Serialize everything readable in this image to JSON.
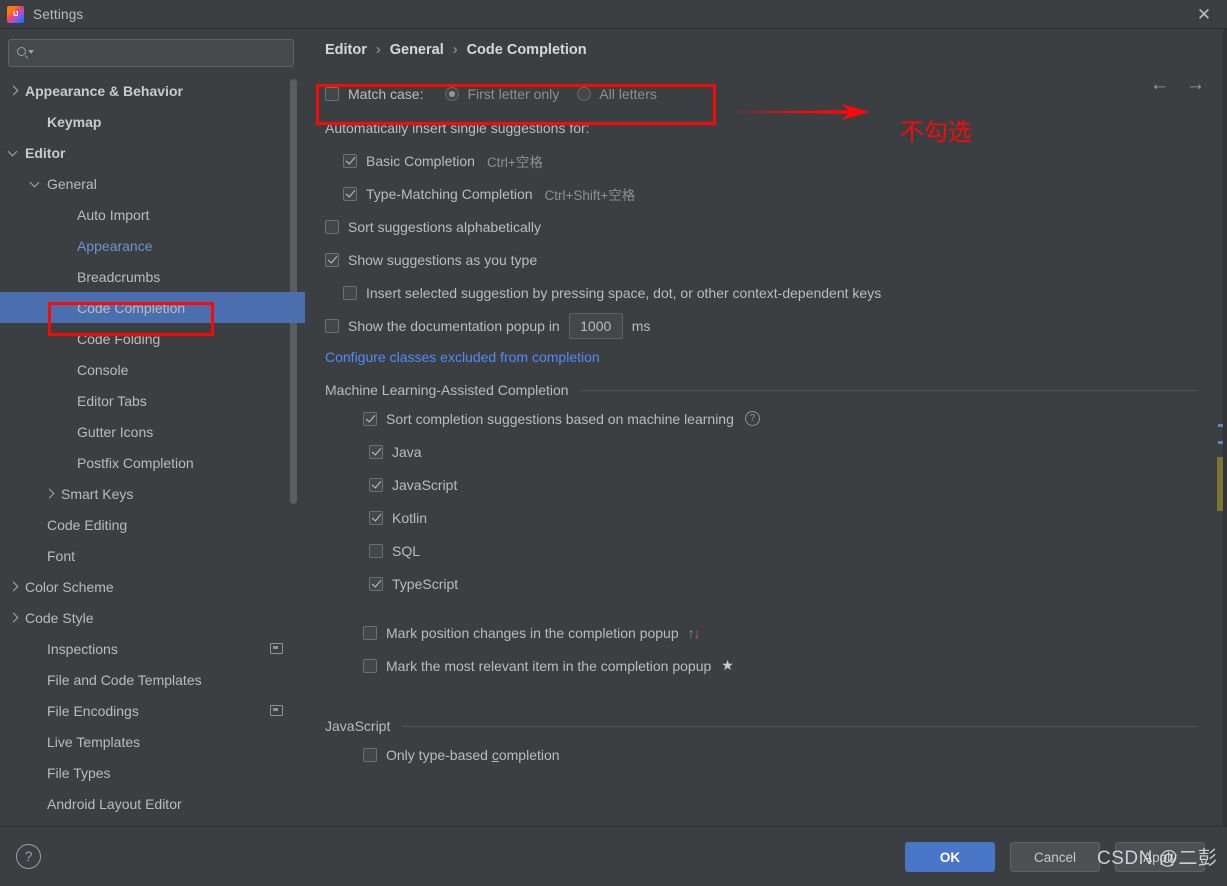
{
  "window": {
    "title": "Settings",
    "logo_icon": "intellij-idea-logo",
    "close_icon": "close-icon"
  },
  "sidebar": {
    "search": {
      "value": "",
      "placeholder": "",
      "icon": "search-icon"
    },
    "items": [
      {
        "label": "Appearance & Behavior",
        "indent": 0,
        "arrow": "right",
        "bold": true,
        "selected": false,
        "accent": false,
        "scope_icon": false
      },
      {
        "label": "Keymap",
        "indent": 1,
        "arrow": "none",
        "bold": true,
        "selected": false,
        "accent": false,
        "scope_icon": false
      },
      {
        "label": "Editor",
        "indent": 0,
        "arrow": "down",
        "bold": true,
        "selected": false,
        "accent": false,
        "scope_icon": false
      },
      {
        "label": "General",
        "indent": 1,
        "arrow": "down",
        "bold": false,
        "selected": false,
        "accent": false,
        "scope_icon": false
      },
      {
        "label": "Auto Import",
        "indent": 3,
        "arrow": "none",
        "bold": false,
        "selected": false,
        "accent": false,
        "scope_icon": false
      },
      {
        "label": "Appearance",
        "indent": 3,
        "arrow": "none",
        "bold": false,
        "selected": false,
        "accent": true,
        "scope_icon": false
      },
      {
        "label": "Breadcrumbs",
        "indent": 3,
        "arrow": "none",
        "bold": false,
        "selected": false,
        "accent": false,
        "scope_icon": false
      },
      {
        "label": "Code Completion",
        "indent": 3,
        "arrow": "none",
        "bold": false,
        "selected": true,
        "accent": false,
        "scope_icon": false
      },
      {
        "label": "Code Folding",
        "indent": 3,
        "arrow": "none",
        "bold": false,
        "selected": false,
        "accent": false,
        "scope_icon": false
      },
      {
        "label": "Console",
        "indent": 3,
        "arrow": "none",
        "bold": false,
        "selected": false,
        "accent": false,
        "scope_icon": false
      },
      {
        "label": "Editor Tabs",
        "indent": 3,
        "arrow": "none",
        "bold": false,
        "selected": false,
        "accent": false,
        "scope_icon": false
      },
      {
        "label": "Gutter Icons",
        "indent": 3,
        "arrow": "none",
        "bold": false,
        "selected": false,
        "accent": false,
        "scope_icon": false
      },
      {
        "label": "Postfix Completion",
        "indent": 3,
        "arrow": "none",
        "bold": false,
        "selected": false,
        "accent": false,
        "scope_icon": false
      },
      {
        "label": "Smart Keys",
        "indent": 2,
        "arrow": "right",
        "bold": false,
        "selected": false,
        "accent": false,
        "scope_icon": false
      },
      {
        "label": "Code Editing",
        "indent": 1,
        "arrow": "none",
        "bold": false,
        "selected": false,
        "accent": false,
        "scope_icon": false
      },
      {
        "label": "Font",
        "indent": 1,
        "arrow": "none",
        "bold": false,
        "selected": false,
        "accent": false,
        "scope_icon": false
      },
      {
        "label": "Color Scheme",
        "indent": 0,
        "arrow": "right",
        "bold": false,
        "selected": false,
        "accent": false,
        "scope_icon": false
      },
      {
        "label": "Code Style",
        "indent": 0,
        "arrow": "right",
        "bold": false,
        "selected": false,
        "accent": false,
        "scope_icon": false
      },
      {
        "label": "Inspections",
        "indent": 1,
        "arrow": "none",
        "bold": false,
        "selected": false,
        "accent": false,
        "scope_icon": true
      },
      {
        "label": "File and Code Templates",
        "indent": 1,
        "arrow": "none",
        "bold": false,
        "selected": false,
        "accent": false,
        "scope_icon": false
      },
      {
        "label": "File Encodings",
        "indent": 1,
        "arrow": "none",
        "bold": false,
        "selected": false,
        "accent": false,
        "scope_icon": true
      },
      {
        "label": "Live Templates",
        "indent": 1,
        "arrow": "none",
        "bold": false,
        "selected": false,
        "accent": false,
        "scope_icon": false
      },
      {
        "label": "File Types",
        "indent": 1,
        "arrow": "none",
        "bold": false,
        "selected": false,
        "accent": false,
        "scope_icon": false
      },
      {
        "label": "Android Layout Editor",
        "indent": 1,
        "arrow": "none",
        "bold": false,
        "selected": false,
        "accent": false,
        "scope_icon": false
      }
    ]
  },
  "content": {
    "breadcrumb": {
      "root": "Editor",
      "middle": "General",
      "leaf": "Code Completion",
      "separator": "›"
    },
    "nav": {
      "back_icon": "arrow-left-icon",
      "forward_icon": "arrow-right-icon"
    },
    "match_case": {
      "label": "Match case:",
      "checked": false,
      "options": [
        {
          "label": "First letter only",
          "selected": true
        },
        {
          "label": "All letters",
          "selected": false
        }
      ]
    },
    "auto_insert_header": "Automatically insert single suggestions for:",
    "auto_insert": [
      {
        "label": "Basic Completion",
        "shortcut": "Ctrl+空格",
        "checked": true
      },
      {
        "label": "Type-Matching Completion",
        "shortcut": "Ctrl+Shift+空格",
        "checked": true
      }
    ],
    "sort_alphabetically": {
      "label": "Sort suggestions alphabetically",
      "checked": false
    },
    "show_as_you_type": {
      "label": "Show suggestions as you type",
      "checked": true
    },
    "insert_selected": {
      "label": "Insert selected suggestion by pressing space, dot, or other context-dependent keys",
      "checked": false
    },
    "doc_popup": {
      "label": "Show the documentation popup in",
      "checked": false,
      "value": "1000",
      "unit": "ms"
    },
    "excluded_link": "Configure classes excluded from completion",
    "ml_section": {
      "title": "Machine Learning-Assisted Completion",
      "main": {
        "label": "Sort completion suggestions based on machine learning",
        "checked": true,
        "help_icon": "help-circle-icon"
      },
      "languages": [
        {
          "label": "Java",
          "checked": true
        },
        {
          "label": "JavaScript",
          "checked": true
        },
        {
          "label": "Kotlin",
          "checked": true
        },
        {
          "label": "SQL",
          "checked": false
        },
        {
          "label": "TypeScript",
          "checked": true
        }
      ]
    },
    "mark_position": {
      "label": "Mark position changes in the completion popup",
      "checked": false,
      "up_glyph": "↑",
      "down_glyph": "↓"
    },
    "mark_relevant": {
      "label": "Mark the most relevant item in the completion popup",
      "checked": false,
      "star_glyph": "★"
    },
    "javascript_section": {
      "title": "JavaScript",
      "only_type_based": {
        "label_pre": "Only type-based ",
        "mnemonic": "c",
        "label_post": "ompletion",
        "checked": false
      }
    }
  },
  "footer": {
    "help_label": "?",
    "ok_label": "OK",
    "cancel_label": "Cancel",
    "apply_label": "Apply"
  },
  "annotations": {
    "arrow_note": "不勾选",
    "color": "#f60a0a"
  },
  "watermark": "CSDN @二彭"
}
